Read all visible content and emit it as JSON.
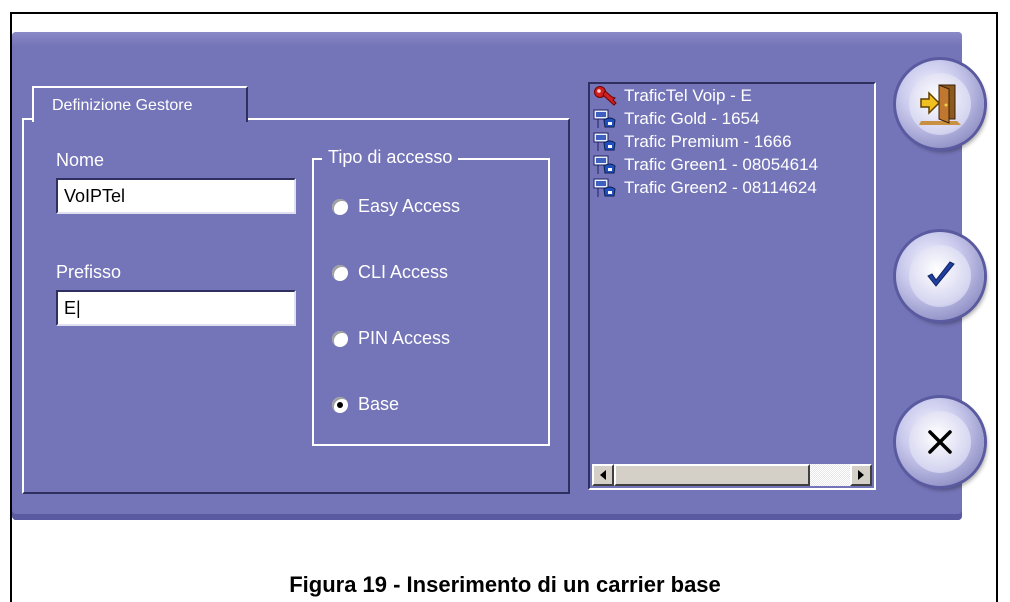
{
  "window": {
    "tab_label": "Definizione Gestore"
  },
  "form": {
    "nome_label": "Nome",
    "nome_value": "VoIPTel",
    "prefisso_label": "Prefisso",
    "prefisso_value": "E|",
    "access_group_label": "Tipo di accesso",
    "access_options": [
      {
        "label": "Easy Access",
        "selected": false
      },
      {
        "label": "CLI Access",
        "selected": false
      },
      {
        "label": "PIN Access",
        "selected": false
      },
      {
        "label": "Base",
        "selected": true
      }
    ]
  },
  "carrier_list": {
    "items": [
      {
        "label": "TraficTel Voip - E",
        "icon": "key-icon"
      },
      {
        "label": "Trafic Gold - 1654",
        "icon": "network-phone-icon"
      },
      {
        "label": "Trafic Premium - 1666",
        "icon": "network-phone-icon"
      },
      {
        "label": "Trafic Green1 - 08054614",
        "icon": "network-phone-icon"
      },
      {
        "label": "Trafic Green2 - 08114624",
        "icon": "network-phone-icon"
      }
    ]
  },
  "actions": {
    "exit_icon": "exit-door-icon",
    "confirm_icon": "checkmark-icon",
    "cancel_icon": "close-icon"
  },
  "caption": "Figura 19 - Inserimento di un carrier base",
  "colors": {
    "window_bg": "#7474b8",
    "text": "#ffffff",
    "accent_red": "#d02020",
    "accent_yellow": "#f0c020"
  }
}
